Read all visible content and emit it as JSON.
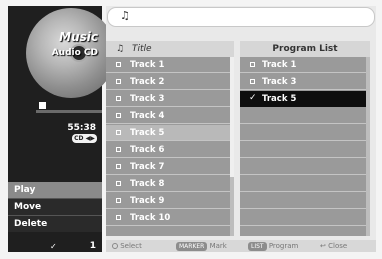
{
  "mode": {
    "title": "Music",
    "disc_type": "Audio CD",
    "elapsed": "55:38",
    "audio_badge": "CD ◀▶",
    "progress_fraction": 0.0
  },
  "menu": [
    {
      "label": "Play",
      "active": true
    },
    {
      "label": "Move",
      "active": false
    },
    {
      "label": "Delete",
      "active": false
    }
  ],
  "selection_count": "1",
  "header_note": "♫",
  "title_list": {
    "header_note": "♫",
    "header": "Title",
    "items": [
      "Track 1",
      "Track 2",
      "Track 3",
      "Track 4",
      "Track 5",
      "Track 6",
      "Track 7",
      "Track 8",
      "Track 9",
      "Track 10"
    ],
    "highlighted_index": 4
  },
  "program_list": {
    "header": "Program List",
    "items": [
      "Track 1",
      "Track 3",
      "Track 5"
    ],
    "selected_index": 2
  },
  "footer": {
    "select": "Select",
    "marker_key": "MARKER",
    "mark": "Mark",
    "list_key": "LIST",
    "program": "Program",
    "close": "Close"
  }
}
